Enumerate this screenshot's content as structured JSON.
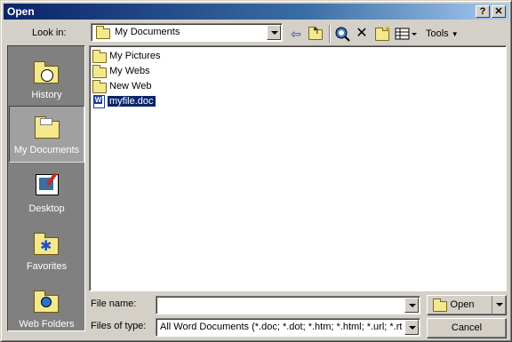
{
  "window": {
    "title": "Open",
    "help_button": "?",
    "close_button": "✕"
  },
  "toolbar": {
    "look_in_label": "Look in:",
    "look_in_value": "My Documents",
    "tools_label": "Tools"
  },
  "places": [
    {
      "label": "History",
      "icon": "history-icon"
    },
    {
      "label": "My Documents",
      "icon": "my-documents-icon"
    },
    {
      "label": "Desktop",
      "icon": "desktop-icon"
    },
    {
      "label": "Favorites",
      "icon": "favorites-icon"
    },
    {
      "label": "Web Folders",
      "icon": "web-folders-icon"
    }
  ],
  "files": [
    {
      "name": "My Pictures",
      "type": "folder"
    },
    {
      "name": "My Webs",
      "type": "folder"
    },
    {
      "name": "New Web",
      "type": "folder"
    },
    {
      "name": "myfile.doc",
      "type": "word-document",
      "selected": true
    }
  ],
  "footer": {
    "file_name_label": "File name:",
    "file_name_value": "",
    "files_of_type_label": "Files of type:",
    "files_of_type_value": "All Word Documents (*.doc; *.dot; *.htm; *.html; *.url; *.rtf; *.mht)",
    "open_label": "Open",
    "cancel_label": "Cancel"
  }
}
